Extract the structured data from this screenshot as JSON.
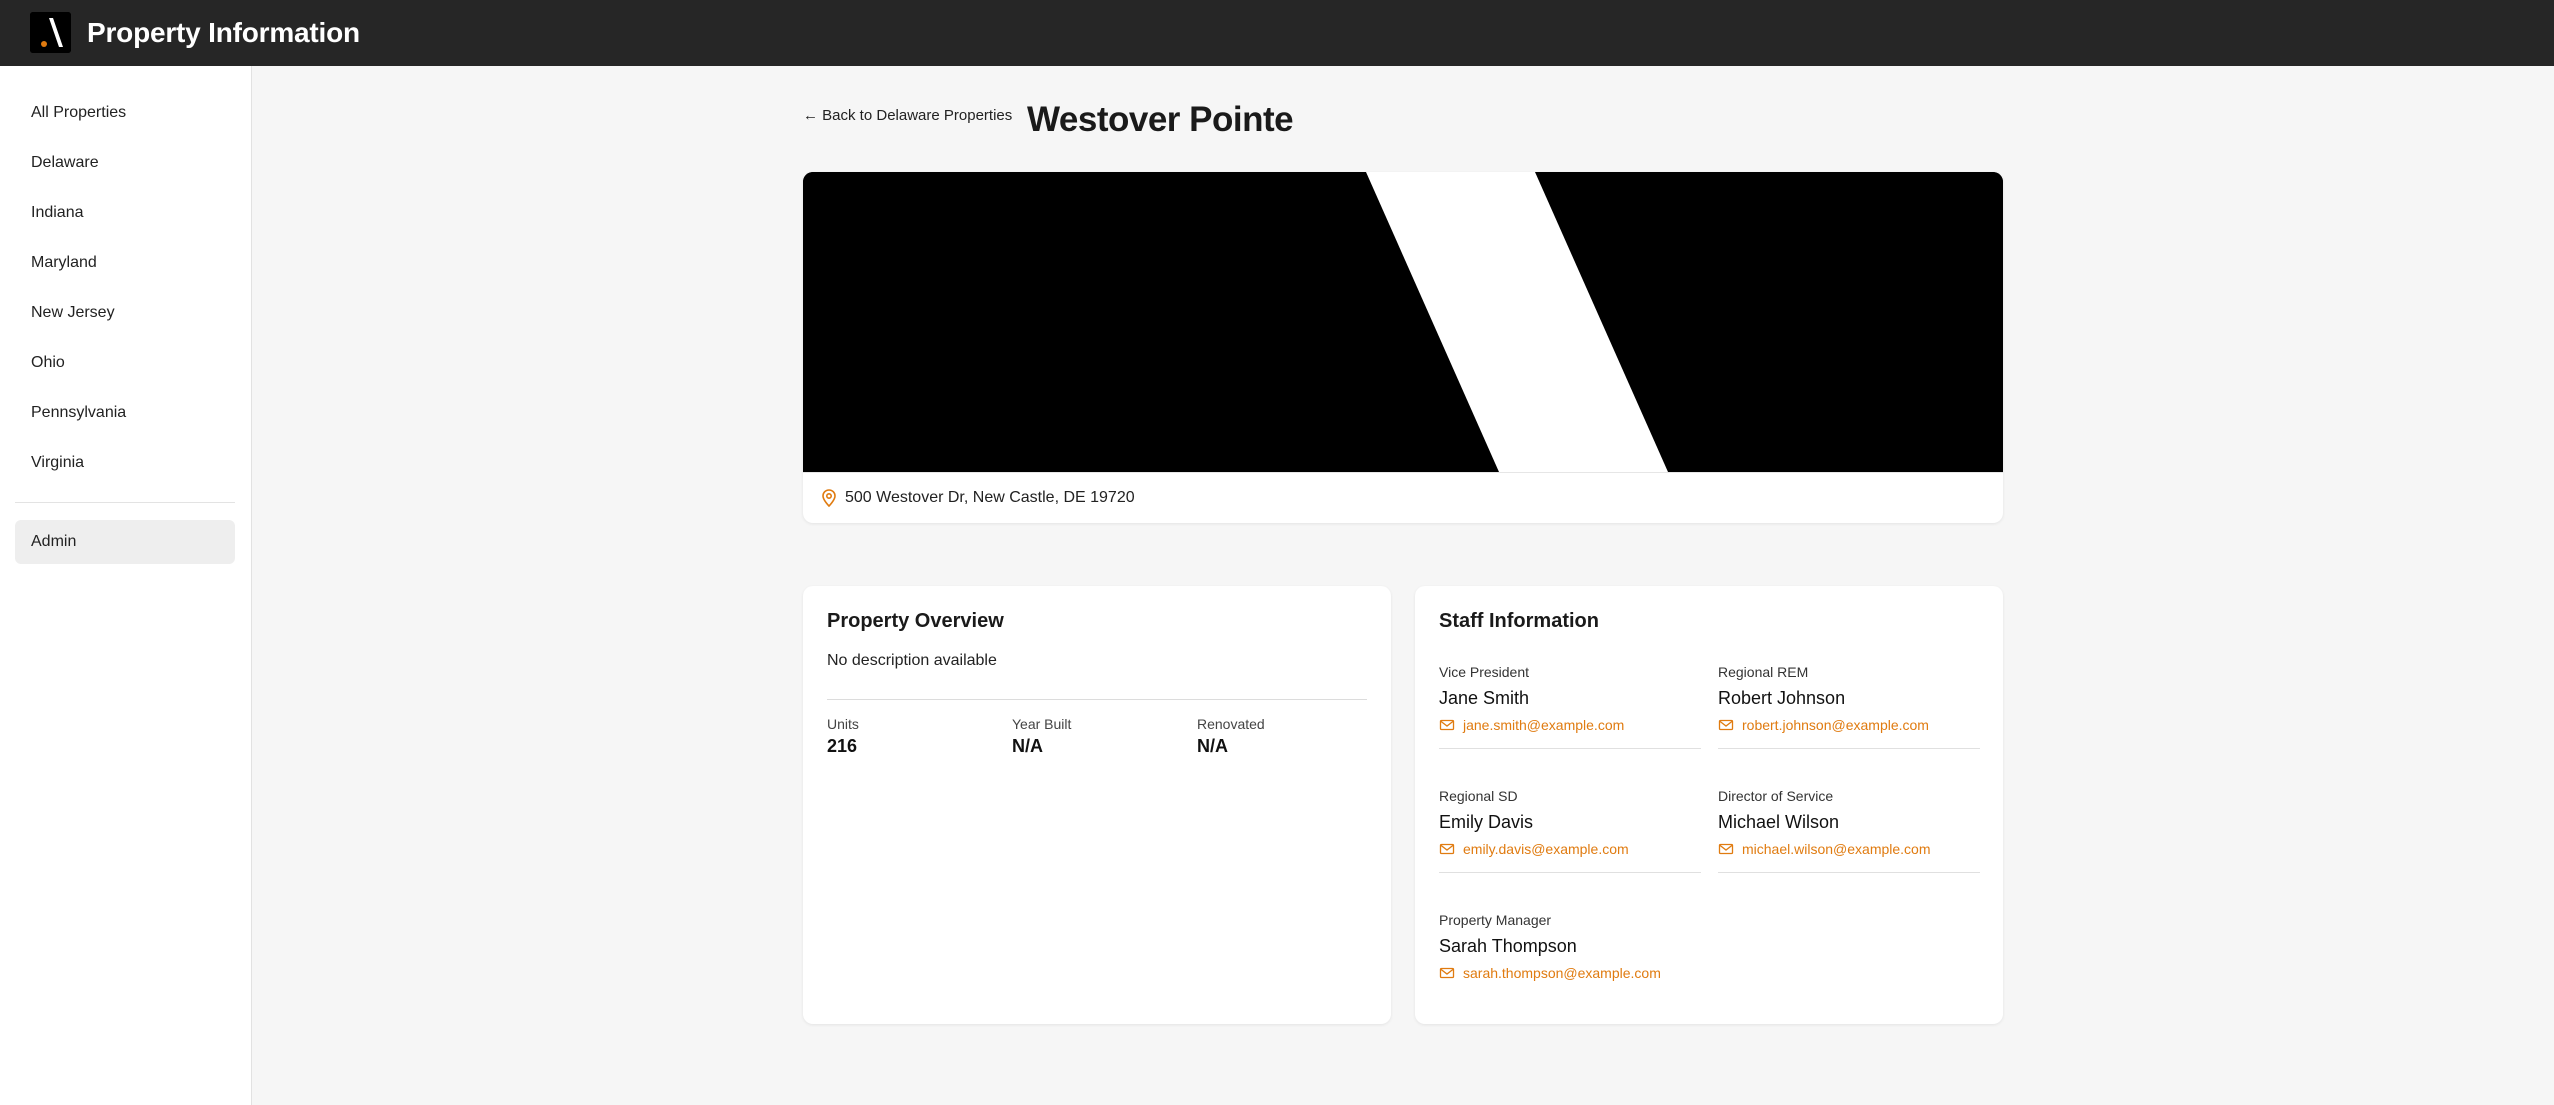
{
  "app": {
    "title": "Property Information",
    "logo_icon": "brand-logo-icon",
    "accent": "#e07b10",
    "header_bg": "#262626"
  },
  "sidebar": {
    "items": [
      {
        "label": "All Properties"
      },
      {
        "label": "Delaware"
      },
      {
        "label": "Indiana"
      },
      {
        "label": "Maryland"
      },
      {
        "label": "New Jersey"
      },
      {
        "label": "Ohio"
      },
      {
        "label": "Pennsylvania"
      },
      {
        "label": "Virginia"
      }
    ],
    "admin_label": "Admin"
  },
  "page": {
    "back_label": "← Back to Delaware Properties",
    "title": "Westover Pointe",
    "address": "500 Westover Dr, New Castle, DE 19720",
    "address_icon": "location-pin-icon"
  },
  "overview": {
    "title": "Property Overview",
    "description": "No description available",
    "stats": [
      {
        "label": "Units",
        "value": "216"
      },
      {
        "label": "Year Built",
        "value": "N/A"
      },
      {
        "label": "Renovated",
        "value": "N/A"
      }
    ]
  },
  "staff": {
    "title": "Staff Information",
    "email_icon": "mail-icon",
    "members": [
      {
        "role": "Vice President",
        "name": "Jane Smith",
        "email": "jane.smith@example.com"
      },
      {
        "role": "Regional REM",
        "name": "Robert Johnson",
        "email": "robert.johnson@example.com"
      },
      {
        "role": "Regional SD",
        "name": "Emily Davis",
        "email": "emily.davis@example.com"
      },
      {
        "role": "Director of Service",
        "name": "Michael Wilson",
        "email": "michael.wilson@example.com"
      },
      {
        "role": "Property Manager",
        "name": "Sarah Thompson",
        "email": "sarah.thompson@example.com"
      }
    ]
  }
}
